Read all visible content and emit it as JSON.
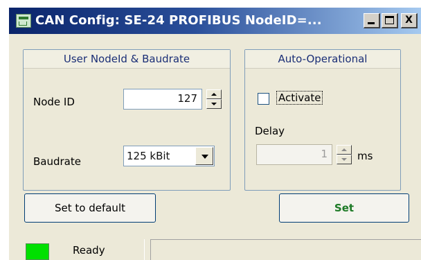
{
  "window": {
    "title": "CAN Config: SE-24 PROFIBUS NodeID=..."
  },
  "title_buttons": {
    "close_label": "X"
  },
  "user_group": {
    "title": "User NodeId & Baudrate",
    "node_id_label": "Node ID",
    "node_id_value": "127",
    "baudrate_label": "Baudrate",
    "baudrate_value": "125 kBit"
  },
  "auto_group": {
    "title": "Auto-Operational",
    "activate_label": "Activate",
    "activate_checked": false,
    "delay_label": "Delay",
    "delay_value": "1",
    "delay_unit": "ms"
  },
  "buttons": {
    "set_default_label": "Set to default",
    "set_label": "Set"
  },
  "status": {
    "text": "Ready",
    "led_color": "#00e000"
  },
  "colors": {
    "title_gradient_start": "#0a246a",
    "title_gradient_end": "#a6caf0",
    "group_title": "#1a2e76",
    "set_button_text": "#1d7a26"
  }
}
